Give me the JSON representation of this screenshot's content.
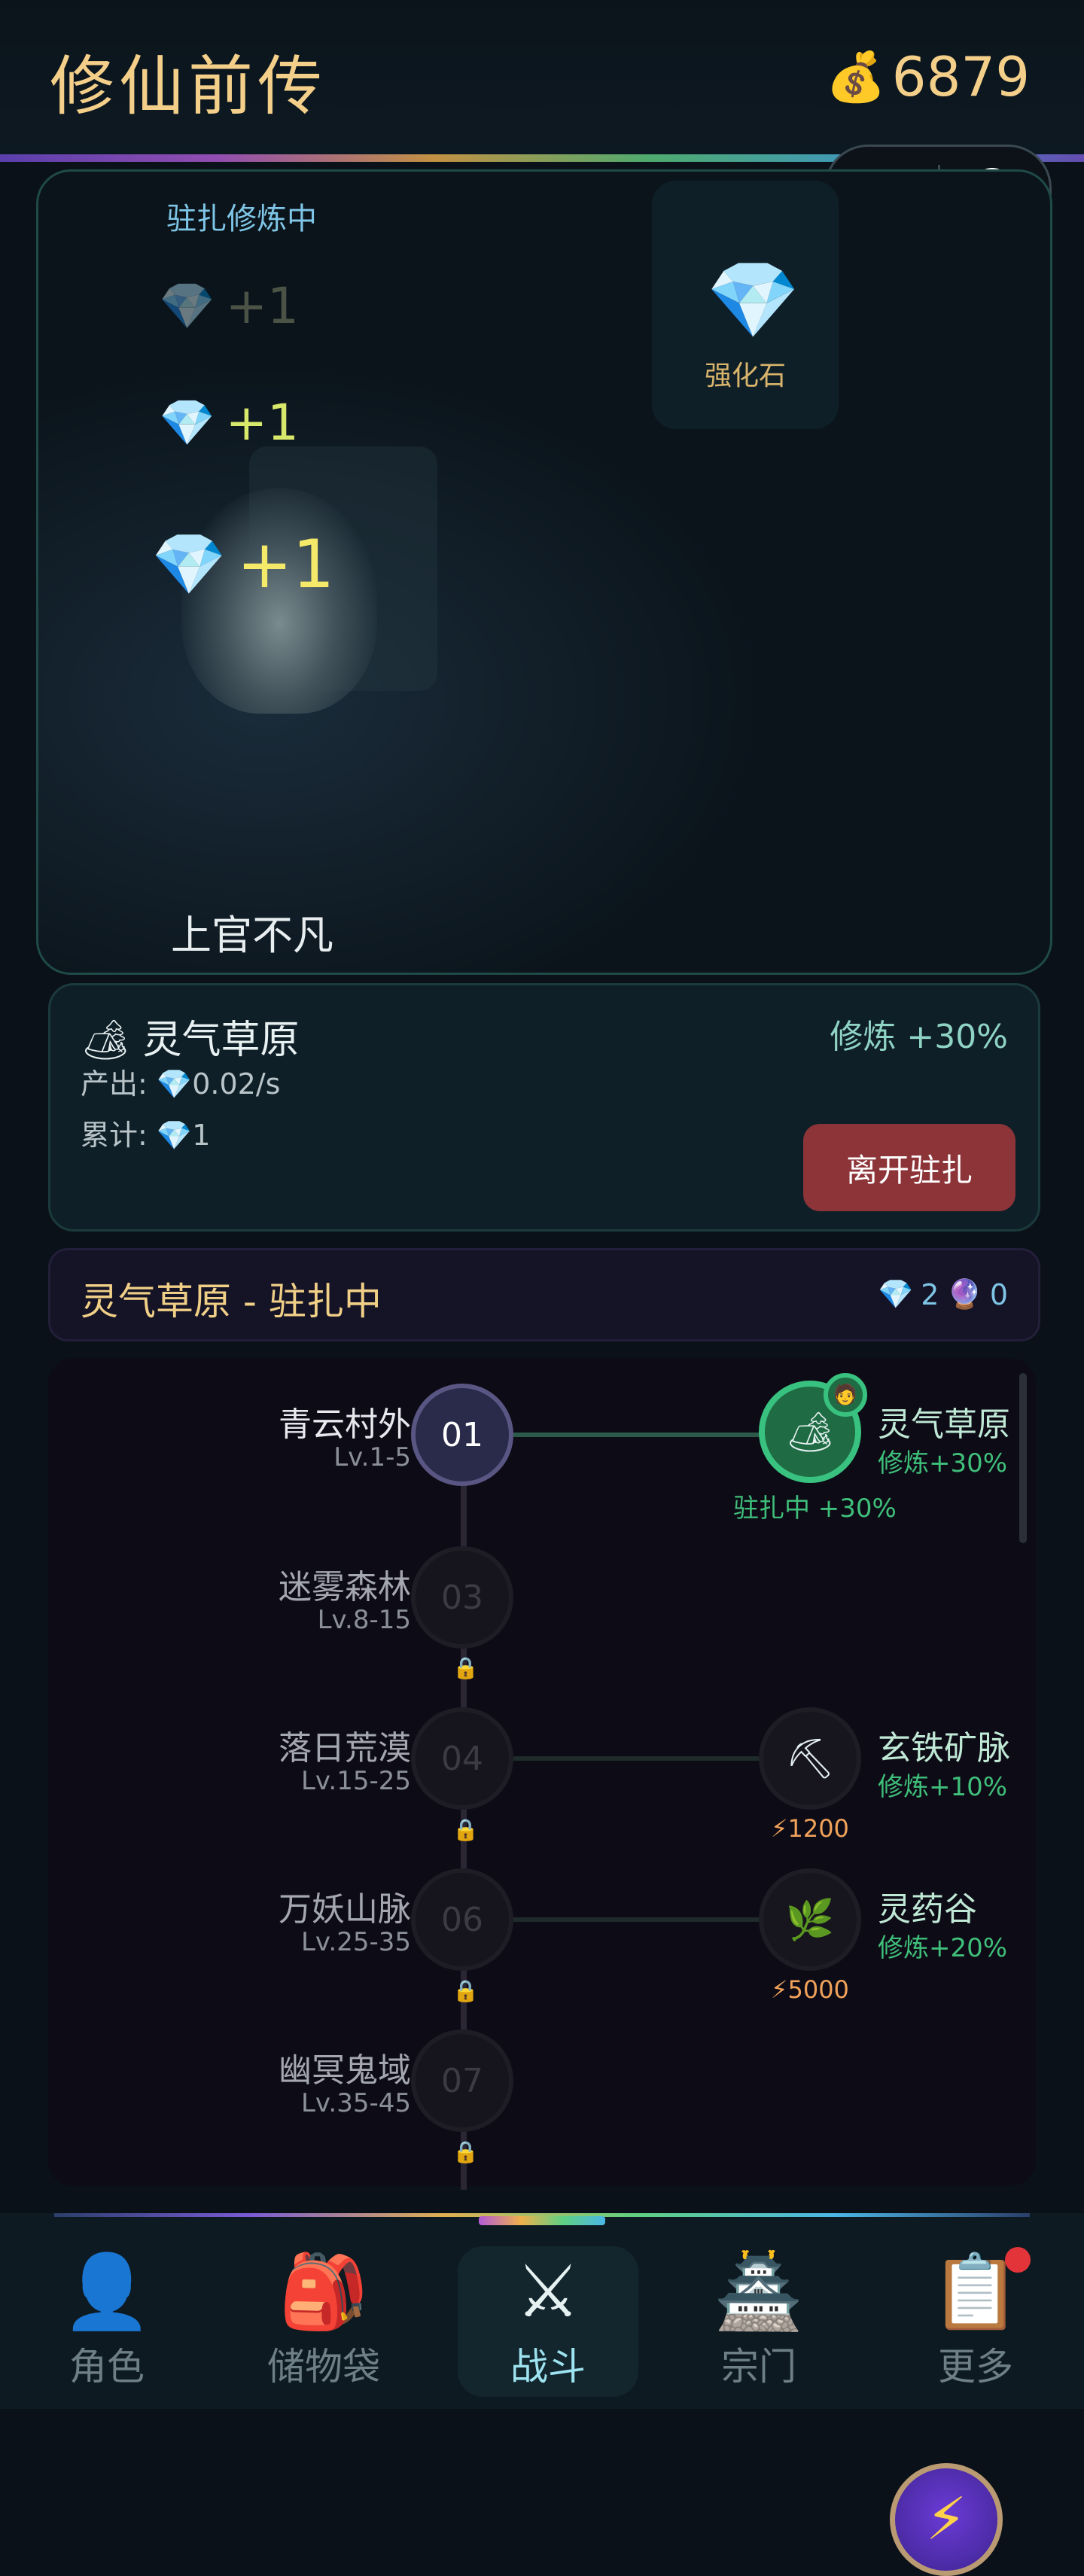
{
  "header": {
    "title": "修仙前传",
    "coin_icon": "money-bag-icon",
    "coins": "6879"
  },
  "mini_program": {
    "more_icon": "ellipsis-icon",
    "close_icon": "target-icon"
  },
  "hero": {
    "status": "驻扎修炼中",
    "floats": [
      {
        "icon": "diamond-icon",
        "text": "+1"
      },
      {
        "icon": "diamond-icon",
        "text": "+1"
      },
      {
        "icon": "diamond-icon",
        "text": "+1"
      }
    ],
    "item": {
      "icon": "diamond-icon",
      "name": "强化石"
    },
    "name": "上官不凡"
  },
  "location": {
    "icon": "camping-icon",
    "title": "灵气草原",
    "bonus": "修炼 +30%",
    "output_label": "产出:",
    "output_value": "0.02/s",
    "total_label": "累计:",
    "total_value": "1",
    "leave_button": "离开驻扎"
  },
  "status_bar": {
    "title": "灵气草原 - 驻扎中",
    "gems": "2",
    "orbs": "0"
  },
  "map": {
    "zones": [
      {
        "name": "青云村外",
        "level": "Lv.1-5",
        "id": "01",
        "locked": false
      },
      {
        "name": "迷雾森林",
        "level": "Lv.8-15",
        "id": "03",
        "locked": true
      },
      {
        "name": "落日荒漠",
        "level": "Lv.15-25",
        "id": "04",
        "locked": true
      },
      {
        "name": "万妖山脉",
        "level": "Lv.25-35",
        "id": "06",
        "locked": true
      },
      {
        "name": "幽冥鬼域",
        "level": "Lv.35-45",
        "id": "07",
        "locked": true
      }
    ],
    "spots": [
      {
        "name": "灵气草原",
        "bonus": "修炼+30%",
        "icon": "camping-icon",
        "status": "驻扎中 +30%"
      },
      {
        "name": "玄铁矿脉",
        "bonus": "修炼+10%",
        "icon": "pickaxe-icon",
        "cost": "1200"
      },
      {
        "name": "灵药谷",
        "bonus": "修炼+20%",
        "icon": "herb-icon",
        "cost": "5000"
      }
    ]
  },
  "nav": {
    "tabs": [
      {
        "label": "角色",
        "icon": "person-icon"
      },
      {
        "label": "储物袋",
        "icon": "backpack-icon"
      },
      {
        "label": "战斗",
        "icon": "crossed-swords-icon"
      },
      {
        "label": "宗门",
        "icon": "castle-icon"
      },
      {
        "label": "更多",
        "icon": "clipboard-icon"
      }
    ]
  }
}
